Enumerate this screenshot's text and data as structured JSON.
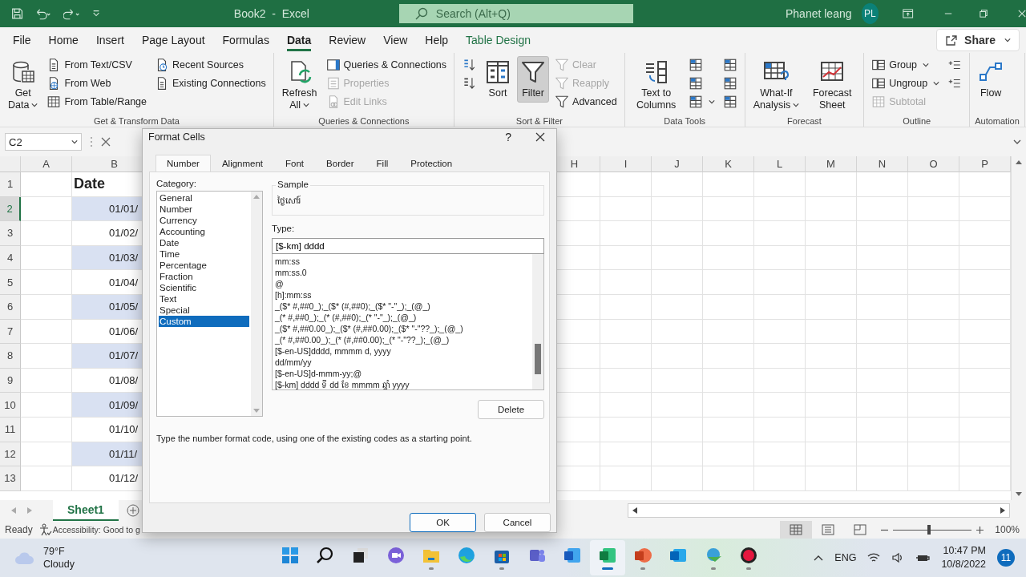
{
  "title_bar": {
    "title": "Book2  -  Excel",
    "search_placeholder": "Search (Alt+Q)",
    "user_name": "Phanet leang",
    "avatar": "PL"
  },
  "menu_tabs": [
    {
      "label": "File",
      "selected": false,
      "kind": "normal"
    },
    {
      "label": "Home",
      "selected": false,
      "kind": "normal"
    },
    {
      "label": "Insert",
      "selected": false,
      "kind": "normal"
    },
    {
      "label": "Page Layout",
      "selected": false,
      "kind": "normal"
    },
    {
      "label": "Formulas",
      "selected": false,
      "kind": "normal"
    },
    {
      "label": "Data",
      "selected": true,
      "kind": "normal"
    },
    {
      "label": "Review",
      "selected": false,
      "kind": "normal"
    },
    {
      "label": "View",
      "selected": false,
      "kind": "normal"
    },
    {
      "label": "Help",
      "selected": false,
      "kind": "normal"
    },
    {
      "label": "Table Design",
      "selected": false,
      "kind": "contextual"
    }
  ],
  "share": "Share",
  "ribbon": {
    "groups": [
      {
        "label": "Get & Transform Data",
        "columns": [
          [
            {
              "kind": "large",
              "label": "Get Data",
              "dropdown": true,
              "disabled": false,
              "on": false
            }
          ],
          [
            {
              "kind": "small",
              "label": "From Text/CSV",
              "disabled": false,
              "on": false
            },
            {
              "kind": "small",
              "label": "From Web",
              "disabled": false,
              "on": false
            },
            {
              "kind": "small",
              "label": "From Table/Range",
              "disabled": false,
              "on": false
            }
          ],
          [
            {
              "kind": "small",
              "label": "Recent Sources",
              "disabled": false,
              "on": false
            },
            {
              "kind": "small",
              "label": "Existing Connections",
              "disabled": false,
              "on": false
            }
          ]
        ]
      },
      {
        "label": "Queries & Connections",
        "columns": [
          [
            {
              "kind": "large",
              "label": "Refresh All",
              "dropdown": true,
              "disabled": false,
              "on": false
            }
          ],
          [
            {
              "kind": "small",
              "label": "Queries & Connections",
              "disabled": false,
              "on": false
            },
            {
              "kind": "small",
              "label": "Properties",
              "disabled": true,
              "on": false
            },
            {
              "kind": "small",
              "label": "Edit Links",
              "disabled": true,
              "on": false
            }
          ]
        ]
      },
      {
        "label": "Sort & Filter",
        "columns": [
          [
            {
              "kind": "icon",
              "disabled": false,
              "on": false
            },
            {
              "kind": "icon",
              "disabled": false,
              "on": false
            }
          ],
          [
            {
              "kind": "large",
              "label": "Sort",
              "disabled": false,
              "on": false
            }
          ],
          [
            {
              "kind": "large",
              "label": "Filter",
              "disabled": false,
              "on": true
            }
          ],
          [
            {
              "kind": "small",
              "label": "Clear",
              "disabled": true,
              "on": false
            },
            {
              "kind": "small",
              "label": "Reapply",
              "disabled": true,
              "on": false
            },
            {
              "kind": "small",
              "label": "Advanced",
              "disabled": false,
              "on": false
            }
          ]
        ]
      },
      {
        "label": "Data Tools",
        "columns": [
          [
            {
              "kind": "large",
              "label": "Text to Columns",
              "disabled": false,
              "on": false
            }
          ],
          [
            {
              "kind": "icon",
              "disabled": false,
              "on": false
            },
            {
              "kind": "icon",
              "disabled": false,
              "on": false
            },
            {
              "kind": "icon",
              "dropdown": true,
              "disabled": false,
              "on": false
            }
          ],
          [
            {
              "kind": "icon",
              "disabled": false,
              "on": false
            },
            {
              "kind": "icon",
              "disabled": false,
              "on": false
            },
            {
              "kind": "icon",
              "disabled": false,
              "on": false
            }
          ]
        ]
      },
      {
        "label": "Forecast",
        "columns": [
          [
            {
              "kind": "large",
              "label": "What-If Analysis",
              "dropdown": true,
              "disabled": false,
              "on": false
            }
          ],
          [
            {
              "kind": "large",
              "label": "Forecast Sheet",
              "disabled": false,
              "on": false
            }
          ]
        ]
      },
      {
        "label": "Outline",
        "columns": [
          [
            {
              "kind": "small",
              "label": "Group",
              "dropdown": true,
              "disabled": false,
              "on": false
            },
            {
              "kind": "small",
              "label": "Ungroup",
              "dropdown": true,
              "disabled": false,
              "on": false
            },
            {
              "kind": "small",
              "label": "Subtotal",
              "disabled": true,
              "on": false
            }
          ],
          [
            {
              "kind": "icon",
              "disabled": false,
              "on": false
            },
            {
              "kind": "icon",
              "disabled": false,
              "on": false
            }
          ]
        ]
      },
      {
        "label": "Automation",
        "columns": [
          [
            {
              "kind": "large",
              "label": "Flow",
              "disabled": false,
              "on": false
            }
          ]
        ]
      }
    ]
  },
  "formula_bar": {
    "name_box": "C2"
  },
  "sheet": {
    "columns": [
      "A",
      "B",
      "H",
      "I",
      "J",
      "K",
      "L",
      "M",
      "N",
      "O",
      "P"
    ],
    "rows": [
      {
        "number": "1",
        "selected": false,
        "kind": "header",
        "value": "Date"
      },
      {
        "number": "2",
        "selected": true,
        "kind": "data",
        "value": "01/01/"
      },
      {
        "number": "3",
        "selected": false,
        "kind": "data",
        "value": "01/02/"
      },
      {
        "number": "4",
        "selected": false,
        "kind": "data",
        "value": "01/03/"
      },
      {
        "number": "5",
        "selected": false,
        "kind": "data",
        "value": "01/04/"
      },
      {
        "number": "6",
        "selected": false,
        "kind": "data",
        "value": "01/05/"
      },
      {
        "number": "7",
        "selected": false,
        "kind": "data",
        "value": "01/06/"
      },
      {
        "number": "8",
        "selected": false,
        "kind": "data",
        "value": "01/07/"
      },
      {
        "number": "9",
        "selected": false,
        "kind": "data",
        "value": "01/08/"
      },
      {
        "number": "10",
        "selected": false,
        "kind": "data",
        "value": "01/09/"
      },
      {
        "number": "11",
        "selected": false,
        "kind": "data",
        "value": "01/10/"
      },
      {
        "number": "12",
        "selected": false,
        "kind": "data",
        "value": "01/11/"
      },
      {
        "number": "13",
        "selected": false,
        "kind": "data",
        "value": "01/12/"
      }
    ]
  },
  "sheet_tabs": [
    {
      "label": "Sheet1",
      "selected": true
    }
  ],
  "status_bar": {
    "status": "Ready",
    "accessibility": "Accessibility: Good to g",
    "views": [
      {
        "selected": true
      },
      {
        "selected": false
      },
      {
        "selected": false
      }
    ],
    "level": 0.45,
    "zoom": "100%"
  },
  "dialog": {
    "title": "Format Cells",
    "help": "?",
    "tabs": [
      {
        "label": "Number",
        "selected": true
      },
      {
        "label": "Alignment",
        "selected": false
      },
      {
        "label": "Font",
        "selected": false
      },
      {
        "label": "Border",
        "selected": false
      },
      {
        "label": "Fill",
        "selected": false
      },
      {
        "label": "Protection",
        "selected": false
      }
    ],
    "category_label": "Category:",
    "categories": [
      {
        "label": "General",
        "selected": false
      },
      {
        "label": "Number",
        "selected": false
      },
      {
        "label": "Currency",
        "selected": false
      },
      {
        "label": "Accounting",
        "selected": false
      },
      {
        "label": "Date",
        "selected": false
      },
      {
        "label": "Time",
        "selected": false
      },
      {
        "label": "Percentage",
        "selected": false
      },
      {
        "label": "Fraction",
        "selected": false
      },
      {
        "label": "Scientific",
        "selected": false
      },
      {
        "label": "Text",
        "selected": false
      },
      {
        "label": "Special",
        "selected": false
      },
      {
        "label": "Custom",
        "selected": true
      }
    ],
    "sample_label": "Sample",
    "sample_value": "ថ្ងៃសៅរ៍",
    "type_label": "Type:",
    "type_value": "[$-km] dddd",
    "formats": [
      "mm:ss",
      "mm:ss.0",
      "@",
      "[h]:mm:ss",
      "_($* #,##0_);_($* (#,##0);_($* \"-\"_);_(@_)",
      "_(* #,##0_);_(* (#,##0);_(* \"-\"_);_(@_)",
      "_($* #,##0.00_);_($* (#,##0.00);_($* \"-\"??_);_(@_)",
      "_(* #,##0.00_);_(* (#,##0.00);_(* \"-\"??_);_(@_)",
      "[$-en-US]dddd, mmmm d, yyyy",
      "dd/mm/yy",
      "[$-en-US]d-mmm-yy;@",
      "[$-km] dddd ទី dd ខែ mmmm ឆ្នាំ yyyy"
    ],
    "delete": "Delete",
    "description": "Type the number format code, using one of the existing codes as a starting point.",
    "ok": "OK",
    "cancel": "Cancel"
  },
  "taskbar": {
    "temperature": "79°F",
    "weather": "Cloudy",
    "apps": [
      {
        "selected": false,
        "open": false
      },
      {
        "selected": false,
        "open": false
      },
      {
        "selected": false,
        "open": false
      },
      {
        "selected": false,
        "open": false
      },
      {
        "selected": false,
        "open": true
      },
      {
        "selected": false,
        "open": false
      },
      {
        "selected": false,
        "open": true
      },
      {
        "selected": false,
        "open": false
      },
      {
        "selected": false,
        "open": false
      },
      {
        "selected": true,
        "open": true
      },
      {
        "selected": false,
        "open": true
      },
      {
        "selected": false,
        "open": false
      },
      {
        "selected": false,
        "open": true
      },
      {
        "selected": false,
        "open": true
      }
    ],
    "language": "ENG",
    "time": "10:47 PM",
    "date": "10/8/2022",
    "notifications": "11"
  }
}
